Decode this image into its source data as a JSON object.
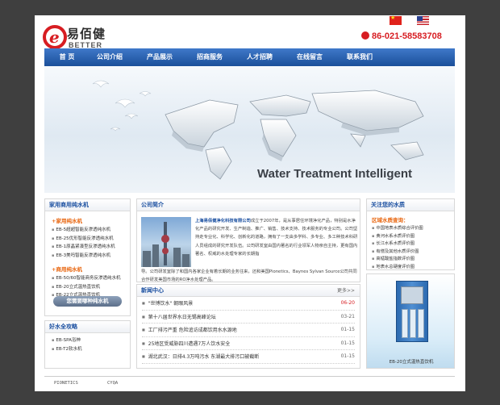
{
  "header": {
    "logo_cn": "易佰健",
    "logo_en": "BETTER",
    "logo_mark": "e",
    "phone": "86-021-58583708"
  },
  "nav": {
    "items": [
      "首 页",
      "公司介绍",
      "产品展示",
      "招商服务",
      "人才招聘",
      "在线留言",
      "联系我们"
    ]
  },
  "banner": {
    "tagline": "Water Treatment Intelligent"
  },
  "products": {
    "title": "家用商用纯水机",
    "household_title": "+家用纯水机",
    "household": [
      "EB-5超超智能反渗透纯水机",
      "EB-25优形智能反渗透纯水机",
      "EB-1原晶紧凑型反渗透纯水机",
      "EB-3美吗智能反渗透纯水机"
    ],
    "commercial_title": "+商用纯水机",
    "commercial": [
      "EB-50/60智能商务反渗透纯水机",
      "EB-20立式温热直饮机",
      "EB-22立式温热直饮机"
    ],
    "more_button": "您需要哪种纯水机"
  },
  "tips": {
    "title": "好水全攻略",
    "items": [
      "EB-SPA浴神",
      "EB-T2软水机"
    ]
  },
  "about": {
    "title": "公司简介",
    "company": "上海易佰健净化科技有限公司",
    "text": "成立于2007年，是从事居住环境净化产品，特别是水净化产品的研究开发、生产制造、推广、销售、技术支持、技术服务的专业公司。公司坚持走专业化、科学化、创新化的道路，拥有了一支由多学科、多专业、多工种技术科研人员组成的研究开发队伍。公司研发室由国内著名的行业领军人物亲自主持，更有国内著名、权威的水处理专家的长期指",
    "text_rest": "导。公司研发室除了和国内各家企业有着长期的业务往来，还和美国Pionetics、Baynes Sylvan Source公司共同合作研发美国市场的RO净水处理产品。"
  },
  "news": {
    "title": "新闻中心",
    "more": "更多>>",
    "items": [
      {
        "title": "\"世博饮水\" 朝眼风景",
        "date": "06-20"
      },
      {
        "title": "第十八届世界水日无锡高峰论坛",
        "date": "03-21"
      },
      {
        "title": "工厂排污严重 危险追访成都饮用水水源地",
        "date": "01-15"
      },
      {
        "title": "25地区受威胁四川遭遇7万人饮水安全",
        "date": "01-15"
      },
      {
        "title": "湖北武汉：日排4.3万吨污水 东湖最大排污口被截断",
        "date": "01-15"
      }
    ]
  },
  "focus": {
    "title": "关注您的水质",
    "region_title": "区域水质查询：",
    "items": [
      "中国地表水质综合评价图",
      "黄河水系水质评价图",
      "长江水系水质评价图",
      "有偿及其他水质评价图",
      "高锰酸盐指数评价图",
      "地表水总硬度评价图"
    ]
  },
  "product_showcase": {
    "caption": "EB-20立式温热直饮机"
  },
  "footer": {
    "links": [
      "PIONETICS",
      "CYQA"
    ]
  },
  "colors": {
    "brand_red": "#d71d22",
    "nav_blue": "#1b4f9a",
    "accent_orange": "#e8650e"
  }
}
